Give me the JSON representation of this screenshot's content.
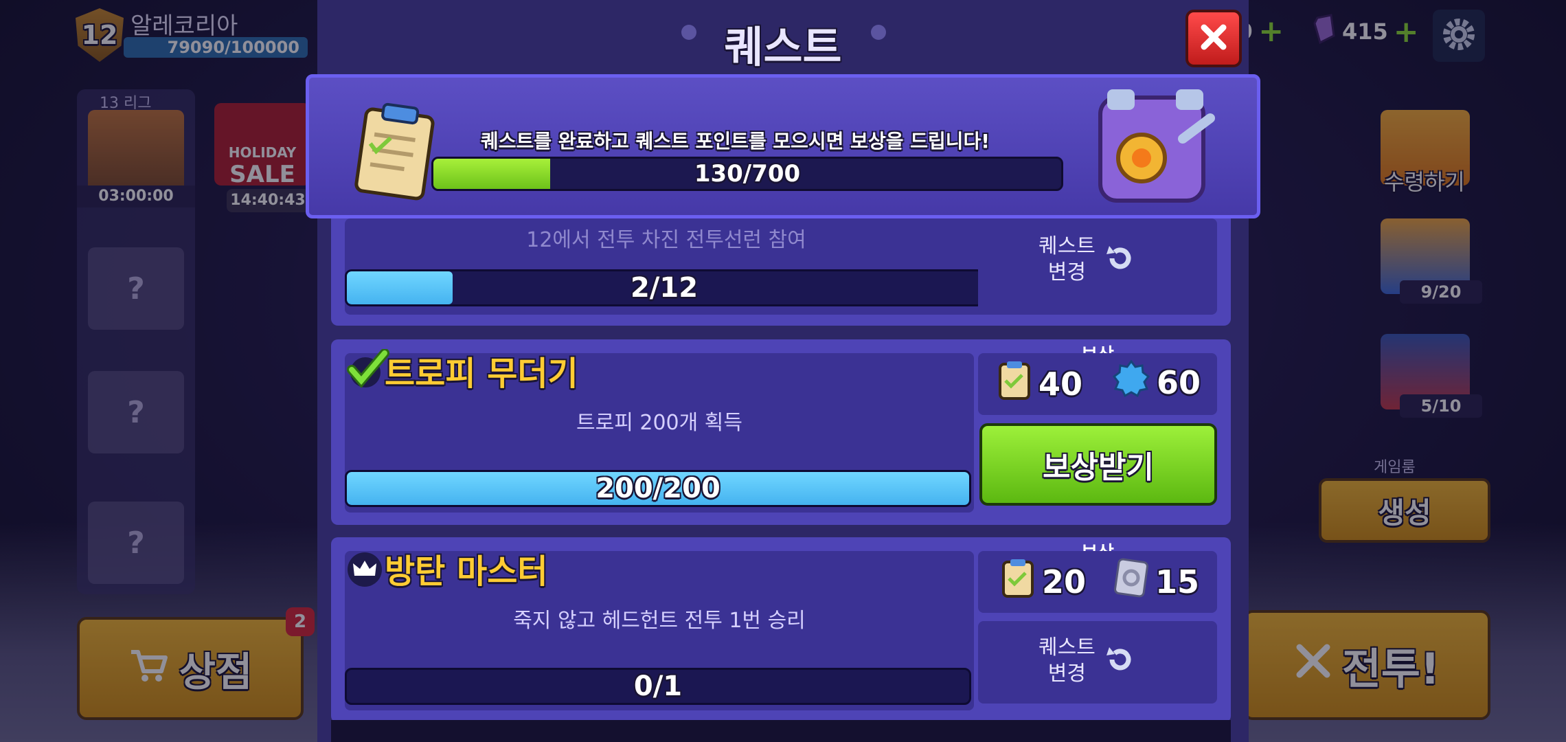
{
  "hud": {
    "level": "12",
    "player_name": "알레코리아",
    "xp": "79090/100000",
    "league_label": "13 리그",
    "league_timer": "03:00:00",
    "sale_line1": "HOLIDAY",
    "sale_line2": "SALE",
    "sale_timer": "14:40:43",
    "shop_label": "상점",
    "shop_badge": "2",
    "coins_partial": "9",
    "gems": "415",
    "claim_label": "수령하기",
    "chest_count_1": "9/20",
    "chest_count_2": "5/10",
    "game_room_label": "게임룸",
    "create_label": "생성",
    "battle_label": "전투!",
    "question_mark": "?"
  },
  "modal": {
    "title": "퀘스트",
    "banner_text": "퀘스트를 완료하고 퀘스트 포인트를 모으시면 보상을 드립니다!",
    "quest_points": "130/700",
    "quest_points_value": 130,
    "quest_points_max": 700
  },
  "quests": [
    {
      "desc_partial": "12에서 전투 차진 전투선런 참여",
      "progress": "2/12",
      "progress_value": 2,
      "progress_max": 12,
      "change_label_1": "퀘스트",
      "change_label_2": "변경"
    },
    {
      "title": "트로피 무더기",
      "desc": "트로피 200개 획득",
      "progress": "200/200",
      "progress_value": 200,
      "progress_max": 200,
      "reward_label": "보상",
      "reward_qp": "40",
      "reward_gold": "60",
      "claim_button": "보상받기"
    },
    {
      "title": "방탄 마스터",
      "desc": "죽지 않고 헤드헌트 전투 1번 승리",
      "progress": "0/1",
      "progress_value": 0,
      "progress_max": 1,
      "reward_label": "보상",
      "reward_qp": "20",
      "reward_card": "15",
      "change_label_1": "퀘스트",
      "change_label_2": "변경"
    }
  ],
  "colors": {
    "modal_bg": "#2d2766",
    "card_bg": "#4e44b6",
    "progress_fill": "#45b3f0",
    "qp_fill": "#6dc21a",
    "title_gold": "#ffcc33",
    "close_red": "#e02b2b"
  }
}
